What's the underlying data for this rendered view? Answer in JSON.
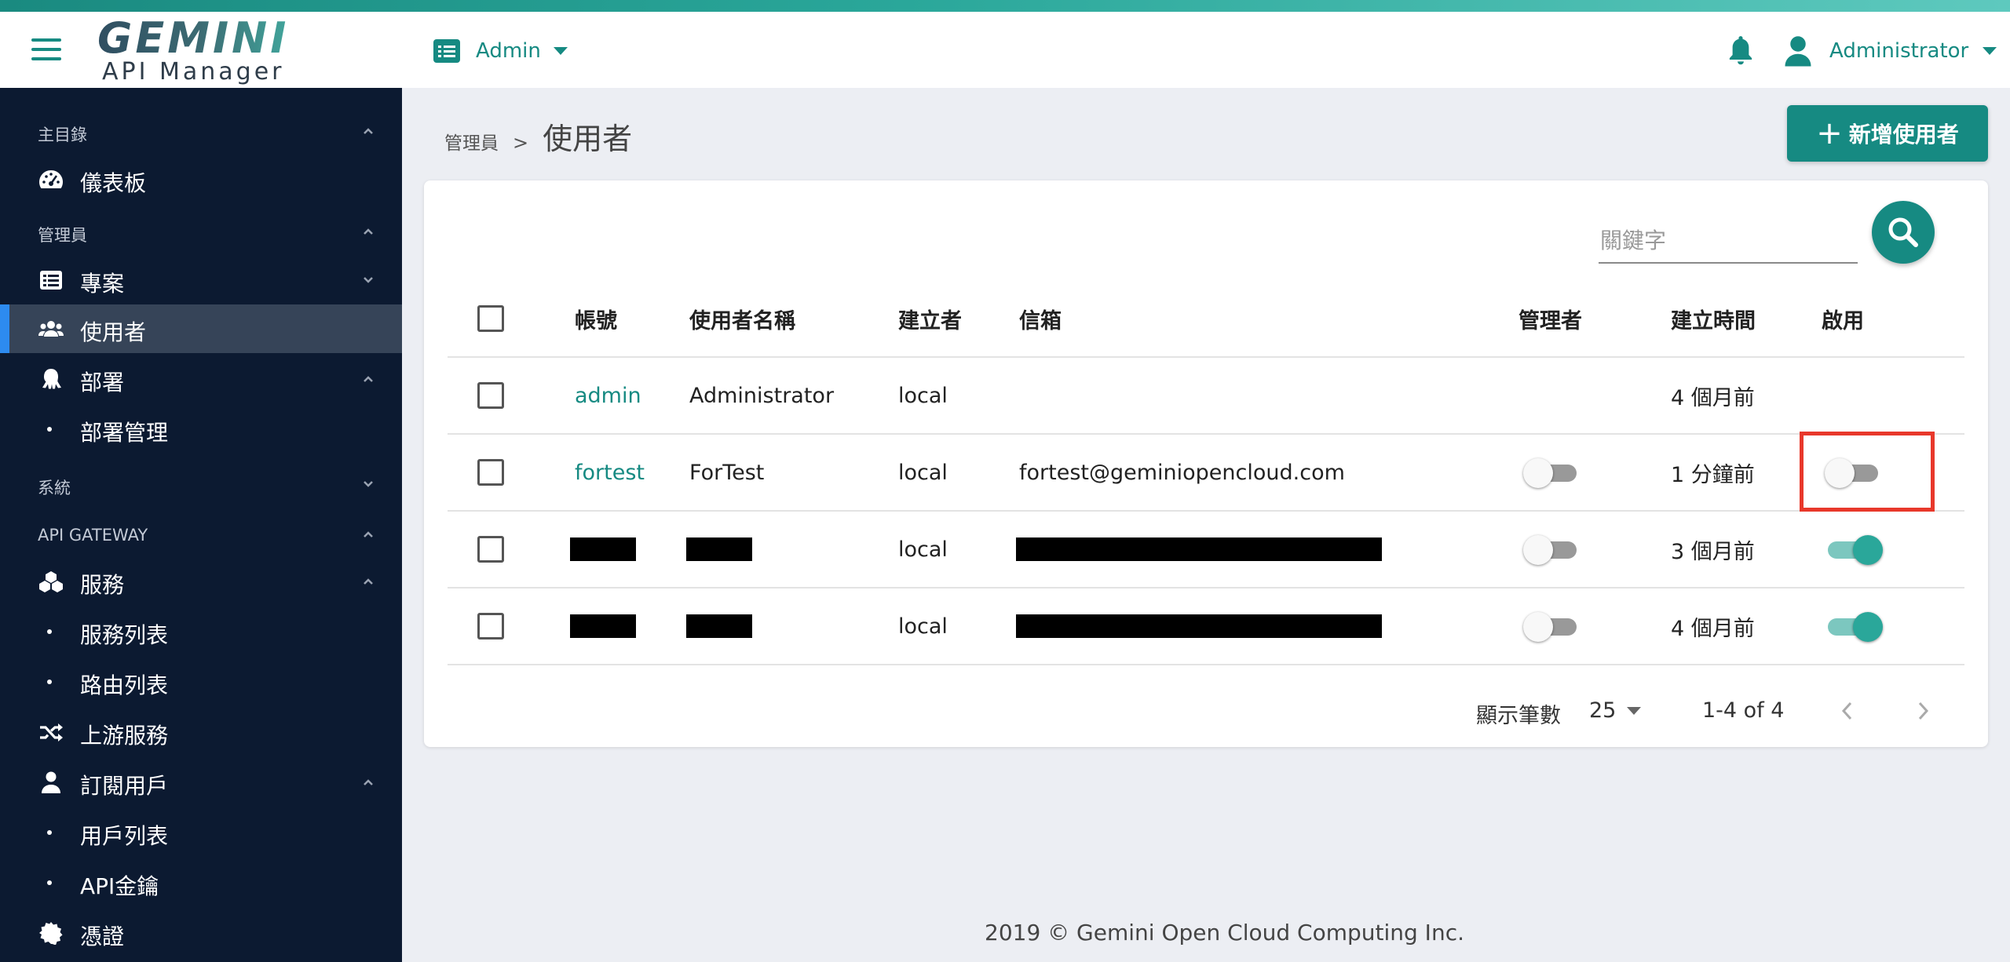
{
  "header": {
    "logo_main": "GEMINI",
    "logo_sub": "API Manager",
    "project": "Admin",
    "user": "Administrator"
  },
  "sidebar": {
    "sections": [
      {
        "label": "主目錄",
        "chevron": "up"
      },
      {
        "label": "管理員",
        "chevron": "up"
      },
      {
        "label": "系統",
        "chevron": "down"
      },
      {
        "label": "API GATEWAY",
        "chevron": "up"
      }
    ],
    "items": [
      {
        "label": "儀表板",
        "icon": "dashboard-icon"
      },
      {
        "label": "專案",
        "icon": "list-icon",
        "chevron": "down"
      },
      {
        "label": "使用者",
        "icon": "users-icon",
        "active": true
      },
      {
        "label": "部署",
        "icon": "octopus-icon",
        "chevron": "up"
      },
      {
        "label": "部署管理"
      },
      {
        "label": "服務",
        "icon": "cubes-icon",
        "chevron": "up"
      },
      {
        "label": "服務列表"
      },
      {
        "label": "路由列表"
      },
      {
        "label": "上游服務",
        "icon": "shuffle-icon"
      },
      {
        "label": "訂閱用戶",
        "icon": "user-icon",
        "chevron": "up"
      },
      {
        "label": "用戶列表"
      },
      {
        "label": "API金鑰"
      },
      {
        "label": "憑證",
        "icon": "certificate-icon"
      }
    ]
  },
  "breadcrumb": {
    "parent": "管理員",
    "separator": ">",
    "current": "使用者"
  },
  "add_button": {
    "label": "新增使用者",
    "icon": "plus-icon"
  },
  "search": {
    "placeholder": "關鍵字",
    "value": ""
  },
  "table": {
    "headers": {
      "account": "帳號",
      "username": "使用者名稱",
      "creator": "建立者",
      "email": "信箱",
      "admin": "管理者",
      "created": "建立時間",
      "enabled": "啟用"
    },
    "rows": [
      {
        "account": "admin",
        "username": "Administrator",
        "creator": "local",
        "email": "",
        "admin": null,
        "created": "4 個月前",
        "enabled": null
      },
      {
        "account": "fortest",
        "username": "ForTest",
        "creator": "local",
        "email": "fortest@geminiopencloud.com",
        "admin": false,
        "created": "1 分鐘前",
        "enabled": false,
        "highlighted": true
      },
      {
        "account": "[redacted]",
        "username": "[redacted]",
        "creator": "local",
        "email": "[redacted]",
        "admin": false,
        "created": "3 個月前",
        "enabled": true
      },
      {
        "account": "[redacted]",
        "username": "[redacted]",
        "creator": "local",
        "email": "[redacted]",
        "admin": false,
        "created": "4 個月前",
        "enabled": true
      }
    ]
  },
  "pagination": {
    "rows_label": "顯示筆數",
    "page_size": "25",
    "range": "1-4 of 4"
  },
  "footer": {
    "text": "2019 © Gemini Open Cloud Computing Inc."
  },
  "colors": {
    "accent": "#168a82",
    "sidebar": "#0c1a31",
    "active_bar": "#2d8bf0",
    "highlight": "#e8382b"
  }
}
